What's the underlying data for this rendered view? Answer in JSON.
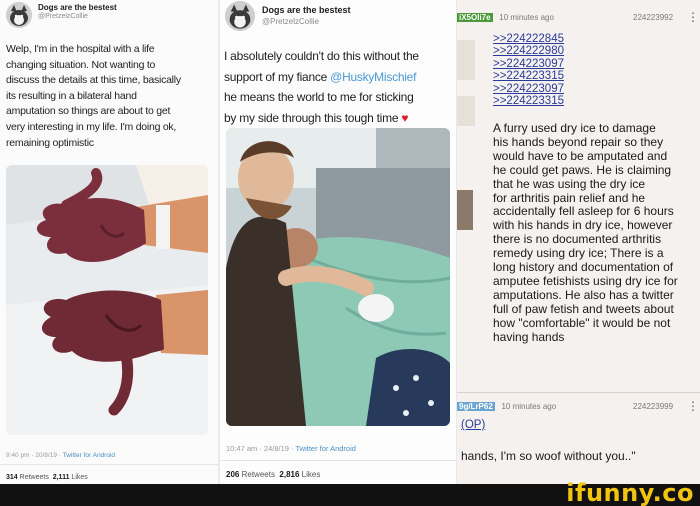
{
  "tweet1": {
    "display_name": "Dogs are the bestest",
    "handle": "@PretzelzCollie",
    "text_lines": [
      "Welp, I'm in the hospital with a life",
      "changing situation. Not wanting to",
      "discuss the details at this time, basically",
      "its resulting in a bilateral hand",
      "amputation so things are about to get",
      "very interesting in my life. I'm doing ok,",
      "remaining optimistic"
    ],
    "time": "9:40 pm · 20/8/19 ·",
    "via": "Twitter for Android",
    "retweets_count": "314",
    "retweets_label": "Retweets",
    "likes_count": "2,111",
    "likes_label": "Likes"
  },
  "tweet2": {
    "display_name": "Dogs are the bestest",
    "handle": "@PretzelzCollie",
    "line1": "I absolutely couldn't do this without the",
    "line2_prefix": "support of my fiance",
    "mention": "@HuskyMischief",
    "line3": "he means the world to me for sticking",
    "line4": "by my side through this tough time",
    "heart": "♥",
    "time": "10:47 am · 24/8/19 ·",
    "via": "Twitter for Android",
    "retweets_count": "206",
    "retweets_label": "Retweets",
    "likes_count": "2,816",
    "likes_label": "Likes"
  },
  "post1": {
    "id_tag": "iX5OIi7e",
    "age": "10 minutes ago",
    "number": "224223992",
    "menu": "⋮",
    "quotes": [
      ">>224222845",
      ">>224222980",
      ">>224223097",
      ">>224223315",
      ">>224223097",
      ">>224223315"
    ],
    "body_lines": [
      "A furry used dry ice to damage",
      "his hands beyond repair so they",
      "would have to be amputated and",
      "he could get paws. He is claiming",
      "that he was using the dry ice",
      "for arthritis pain relief and he",
      "accidentally fell asleep for 6 hours",
      "with his hands in dry ice, however",
      "there is no documented arthritis",
      "remedy using dry ice; There is a",
      "long history and documentation of",
      "amputee fetishists using dry ice for",
      "amputations. He also has a twitter",
      "full of paw fetish and tweets about",
      "how \"comfortable\" it would be not",
      "having hands"
    ]
  },
  "post2": {
    "id_tag": "9g/LrP62",
    "age": "10 minutes ago",
    "number": "224223999",
    "menu": "⋮",
    "op_link": "(OP)",
    "body": "hands, I'm so woof without you..\""
  },
  "footer": {
    "brand": "ifunny.co"
  },
  "colors": {
    "mention": "#4a98d6",
    "heart": "#d8202e",
    "quotelink": "#2a3a9a",
    "brand": "#f1c40f",
    "footer_bg": "#111111"
  }
}
